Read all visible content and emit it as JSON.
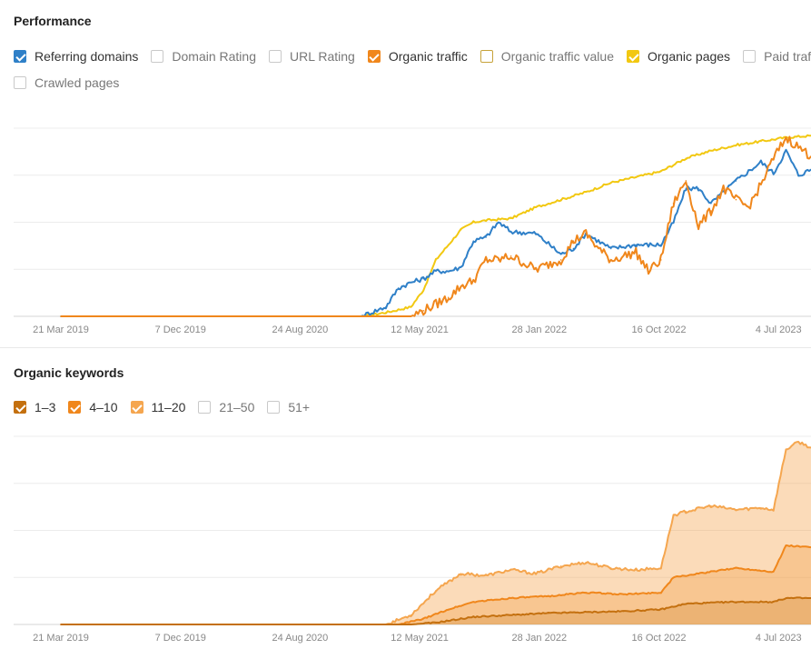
{
  "performance": {
    "title": "Performance",
    "legend": [
      {
        "label": "Referring domains",
        "checked": true,
        "color": "#2f80c8"
      },
      {
        "label": "Domain Rating",
        "checked": false,
        "color": "#c9c9c9"
      },
      {
        "label": "URL Rating",
        "checked": false,
        "color": "#c9c9c9"
      },
      {
        "label": "Organic traffic",
        "checked": true,
        "color": "#f0871c"
      },
      {
        "label": "Organic traffic value",
        "checked": false,
        "color": "#c7a23a"
      },
      {
        "label": "Organic pages",
        "checked": true,
        "color": "#f2c811"
      },
      {
        "label": "Paid traffic",
        "checked": false,
        "color": "#c9c9c9"
      },
      {
        "label": "Crawled pages",
        "checked": false,
        "color": "#c9c9c9"
      }
    ]
  },
  "organic_keywords": {
    "title": "Organic keywords",
    "legend": [
      {
        "label": "1–3",
        "checked": true,
        "color": "#c4700f"
      },
      {
        "label": "4–10",
        "checked": true,
        "color": "#f0871c"
      },
      {
        "label": "11–20",
        "checked": true,
        "color": "#f5a64f"
      },
      {
        "label": "21–50",
        "checked": false,
        "color": "#c9c9c9"
      },
      {
        "label": "51+",
        "checked": false,
        "color": "#c9c9c9"
      }
    ]
  },
  "chart_data": [
    {
      "type": "line",
      "title": "Performance",
      "x_tick_labels": [
        "21 Mar 2019",
        "7 Dec 2019",
        "24 Aug 2020",
        "12 May 2021",
        "28 Jan 2022",
        "16 Oct 2022",
        "4 Jul 2023"
      ],
      "x_range": [
        "2018-10",
        "2023-10"
      ],
      "y_range": [
        0,
        100
      ],
      "y_tick_labels_visible": false,
      "grid": true,
      "series": [
        {
          "name": "Organic pages",
          "color": "#f2c811",
          "points": [
            [
              "2018-10",
              0
            ],
            [
              "2020-10",
              0
            ],
            [
              "2020-12",
              2
            ],
            [
              "2021-02",
              5
            ],
            [
              "2021-03",
              14
            ],
            [
              "2021-04",
              30
            ],
            [
              "2021-05",
              38
            ],
            [
              "2021-06",
              46
            ],
            [
              "2021-07",
              50
            ],
            [
              "2021-08",
              51
            ],
            [
              "2021-10",
              52
            ],
            [
              "2021-12",
              58
            ],
            [
              "2022-02",
              62
            ],
            [
              "2022-04",
              66
            ],
            [
              "2022-06",
              71
            ],
            [
              "2022-08",
              74
            ],
            [
              "2022-10",
              77
            ],
            [
              "2022-12",
              84
            ],
            [
              "2023-02",
              88
            ],
            [
              "2023-04",
              91
            ],
            [
              "2023-06",
              93
            ],
            [
              "2023-08",
              95
            ],
            [
              "2023-10",
              96
            ]
          ]
        },
        {
          "name": "Referring domains",
          "color": "#2f80c8",
          "points": [
            [
              "2018-10",
              0
            ],
            [
              "2020-10",
              0
            ],
            [
              "2020-12",
              5
            ],
            [
              "2021-01",
              15
            ],
            [
              "2021-02",
              18
            ],
            [
              "2021-03",
              20
            ],
            [
              "2021-04",
              24
            ],
            [
              "2021-05",
              24
            ],
            [
              "2021-06",
              26
            ],
            [
              "2021-07",
              40
            ],
            [
              "2021-08",
              42
            ],
            [
              "2021-09",
              50
            ],
            [
              "2021-10",
              45
            ],
            [
              "2021-12",
              44
            ],
            [
              "2022-02",
              33
            ],
            [
              "2022-03",
              36
            ],
            [
              "2022-04",
              44
            ],
            [
              "2022-05",
              40
            ],
            [
              "2022-06",
              36
            ],
            [
              "2022-08",
              38
            ],
            [
              "2022-10",
              38
            ],
            [
              "2022-11",
              50
            ],
            [
              "2022-12",
              68
            ],
            [
              "2023-01",
              68
            ],
            [
              "2023-02",
              60
            ],
            [
              "2023-04",
              72
            ],
            [
              "2023-06",
              82
            ],
            [
              "2023-07",
              76
            ],
            [
              "2023-08",
              88
            ],
            [
              "2023-09",
              75
            ],
            [
              "2023-10",
              78
            ]
          ]
        },
        {
          "name": "Organic traffic",
          "color": "#f0871c",
          "points": [
            [
              "2018-10",
              0
            ],
            [
              "2021-02",
              0
            ],
            [
              "2021-03",
              3
            ],
            [
              "2021-05",
              10
            ],
            [
              "2021-06",
              16
            ],
            [
              "2021-07",
              19
            ],
            [
              "2021-08",
              30
            ],
            [
              "2021-09",
              30
            ],
            [
              "2021-10",
              32
            ],
            [
              "2021-12",
              25
            ],
            [
              "2022-02",
              30
            ],
            [
              "2022-03",
              40
            ],
            [
              "2022-04",
              44
            ],
            [
              "2022-05",
              36
            ],
            [
              "2022-06",
              30
            ],
            [
              "2022-08",
              34
            ],
            [
              "2022-09",
              24
            ],
            [
              "2022-10",
              30
            ],
            [
              "2022-11",
              60
            ],
            [
              "2022-12",
              72
            ],
            [
              "2023-01",
              48
            ],
            [
              "2023-02",
              56
            ],
            [
              "2023-03",
              68
            ],
            [
              "2023-04",
              62
            ],
            [
              "2023-05",
              58
            ],
            [
              "2023-06",
              70
            ],
            [
              "2023-07",
              84
            ],
            [
              "2023-08",
              95
            ],
            [
              "2023-09",
              90
            ],
            [
              "2023-10",
              85
            ]
          ]
        }
      ]
    },
    {
      "type": "area",
      "title": "Organic keywords",
      "stacked": true,
      "x_tick_labels": [
        "21 Mar 2019",
        "7 Dec 2019",
        "24 Aug 2020",
        "12 May 2021",
        "28 Jan 2022",
        "16 Oct 2022",
        "4 Jul 2023"
      ],
      "x_range": [
        "2018-10",
        "2023-10"
      ],
      "y_range": [
        0,
        100
      ],
      "y_tick_labels_visible": false,
      "grid": true,
      "series": [
        {
          "name": "11–20",
          "color": "#f5a64f",
          "points": [
            [
              "2018-10",
              0
            ],
            [
              "2020-12",
              0
            ],
            [
              "2021-02",
              5
            ],
            [
              "2021-04",
              18
            ],
            [
              "2021-06",
              27
            ],
            [
              "2021-08",
              26
            ],
            [
              "2021-10",
              29
            ],
            [
              "2021-12",
              27
            ],
            [
              "2022-02",
              31
            ],
            [
              "2022-04",
              33
            ],
            [
              "2022-06",
              30
            ],
            [
              "2022-08",
              29
            ],
            [
              "2022-10",
              30
            ],
            [
              "2022-11",
              58
            ],
            [
              "2022-12",
              60
            ],
            [
              "2023-02",
              63
            ],
            [
              "2023-04",
              61
            ],
            [
              "2023-06",
              62
            ],
            [
              "2023-07",
              61
            ],
            [
              "2023-08",
              93
            ],
            [
              "2023-09",
              97
            ],
            [
              "2023-10",
              94
            ]
          ]
        },
        {
          "name": "4–10",
          "color": "#f0871c",
          "points": [
            [
              "2018-10",
              0
            ],
            [
              "2021-01",
              0
            ],
            [
              "2021-03",
              3
            ],
            [
              "2021-05",
              8
            ],
            [
              "2021-07",
              12
            ],
            [
              "2021-10",
              14
            ],
            [
              "2022-01",
              15
            ],
            [
              "2022-04",
              17
            ],
            [
              "2022-07",
              16
            ],
            [
              "2022-10",
              17
            ],
            [
              "2022-11",
              25
            ],
            [
              "2023-01",
              27
            ],
            [
              "2023-04",
              30
            ],
            [
              "2023-07",
              28
            ],
            [
              "2023-08",
              42
            ],
            [
              "2023-10",
              41
            ]
          ]
        },
        {
          "name": "1–3",
          "color": "#c4700f",
          "points": [
            [
              "2018-10",
              0
            ],
            [
              "2021-02",
              0
            ],
            [
              "2021-04",
              1
            ],
            [
              "2021-07",
              4
            ],
            [
              "2022-01",
              6
            ],
            [
              "2022-07",
              7
            ],
            [
              "2022-10",
              8
            ],
            [
              "2022-12",
              11
            ],
            [
              "2023-04",
              12
            ],
            [
              "2023-07",
              12
            ],
            [
              "2023-08",
              14
            ],
            [
              "2023-10",
              14
            ]
          ]
        }
      ]
    }
  ]
}
